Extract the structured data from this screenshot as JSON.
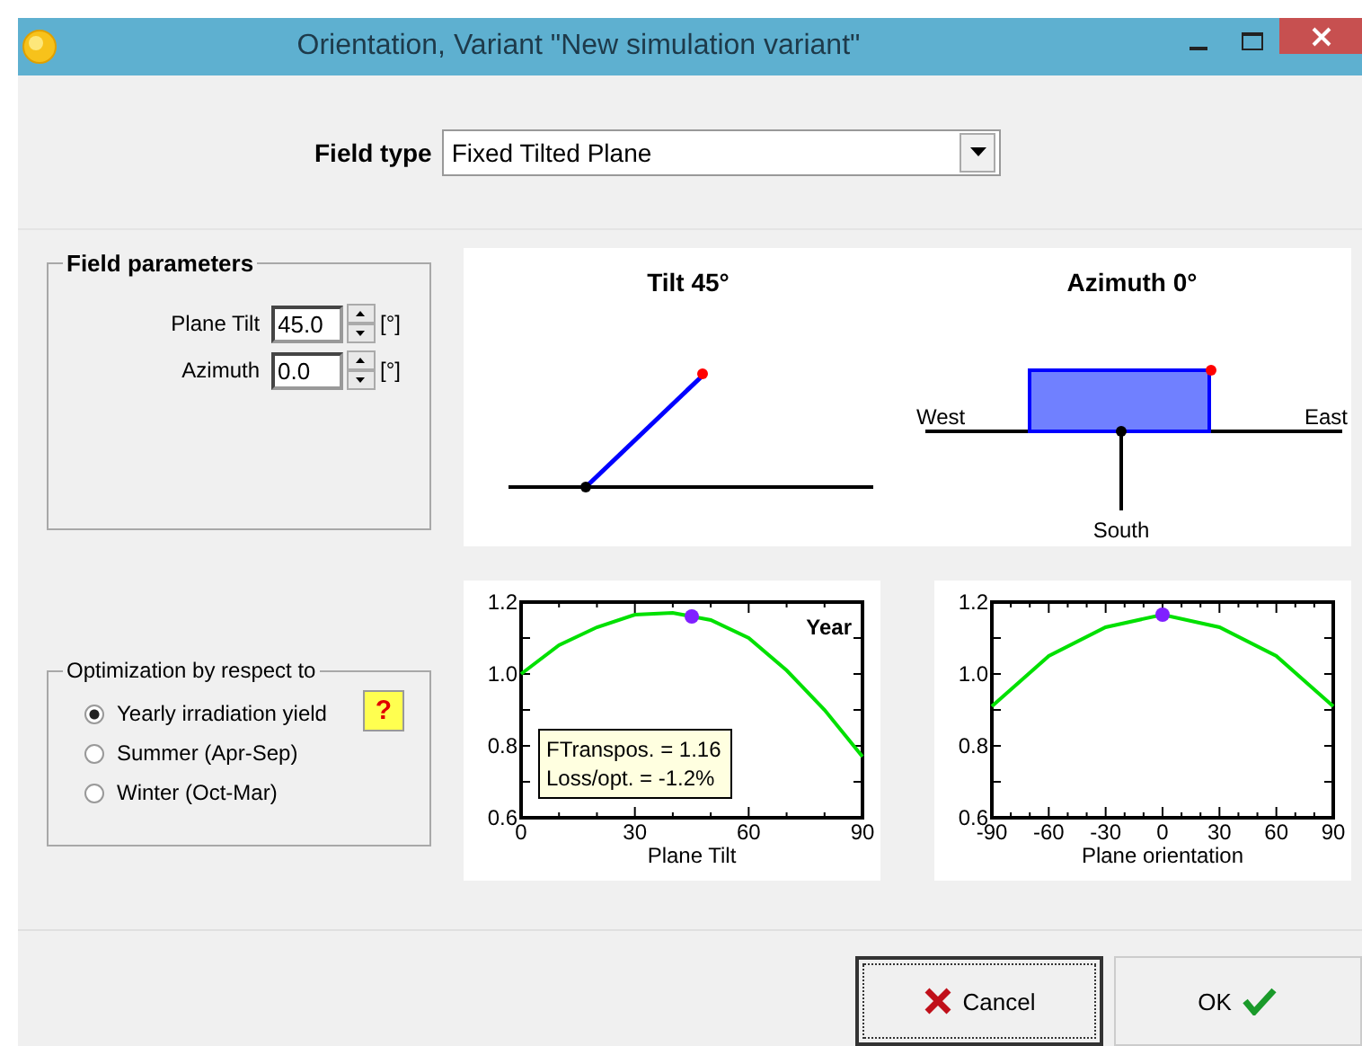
{
  "window": {
    "title": "Orientation, Variant \"New simulation variant\""
  },
  "field_type": {
    "label": "Field type",
    "value": "Fixed Tilted Plane"
  },
  "field_parameters": {
    "title": "Field parameters",
    "fields": [
      {
        "label": "Plane Tilt",
        "value": "45.0",
        "unit": "[°]"
      },
      {
        "label": "Azimuth",
        "value": "0.0",
        "unit": "[°]"
      }
    ]
  },
  "diagrams": {
    "tilt_title": "Tilt 45°",
    "azimuth_title": "Azimuth 0°",
    "west": "West",
    "east": "East",
    "south": "South"
  },
  "charts": [
    {
      "info": [
        "FTranspos. = 1.16",
        "Loss/opt. = -1.2%"
      ],
      "chart_data": {
        "type": "line",
        "xlabel": "Plane Tilt",
        "x": [
          0,
          10,
          20,
          30,
          40,
          50,
          60,
          70,
          80,
          90
        ],
        "series": [
          {
            "name": "Year",
            "color": "#00e000",
            "values": [
              1.0,
              1.08,
              1.13,
              1.165,
              1.17,
              1.15,
              1.1,
              1.01,
              0.9,
              0.77
            ]
          }
        ],
        "xlim": [
          0,
          90
        ],
        "ylim": [
          0.6,
          1.2
        ],
        "xticks": [
          0,
          30,
          60,
          90
        ],
        "yticks": [
          {
            "value": 0.6,
            "label": "0.6"
          },
          {
            "value": 0.8,
            "label": "0.8"
          },
          {
            "value": 1.0,
            "label": "1.0"
          },
          {
            "value": 1.2,
            "label": "1.2"
          }
        ]
      }
    },
    {
      "chart_data": {
        "type": "line",
        "xlabel": "Plane orientation",
        "x": [
          -90,
          -60,
          -30,
          0,
          30,
          60,
          90
        ],
        "series": [
          {
            "color": "#00e000",
            "values": [
              0.91,
              1.05,
              1.13,
              1.165,
              1.13,
              1.05,
              0.91
            ]
          }
        ],
        "xlim": [
          -90,
          90
        ],
        "ylim": [
          0.6,
          1.2
        ],
        "xticks": [
          -90,
          -60,
          -30,
          0,
          30,
          60,
          90
        ],
        "yticks": [
          {
            "value": 0.6,
            "label": "0.6"
          },
          {
            "value": 0.8,
            "label": "0.8"
          },
          {
            "value": 1.0,
            "label": "1.0"
          },
          {
            "value": 1.2,
            "label": "1.2"
          }
        ]
      }
    }
  ],
  "optimization": {
    "title": "Optimization by respect to",
    "help": "?",
    "options": [
      {
        "label": "Yearly irradiation yield",
        "selected": true
      },
      {
        "label": "Summer (Apr-Sep)",
        "selected": false
      },
      {
        "label": "Winter (Oct-Mar)",
        "selected": false
      }
    ]
  },
  "buttons": [
    {
      "label": "Cancel",
      "kind": "cancel",
      "focused": true
    },
    {
      "label": "OK",
      "kind": "ok",
      "focused": false
    }
  ]
}
